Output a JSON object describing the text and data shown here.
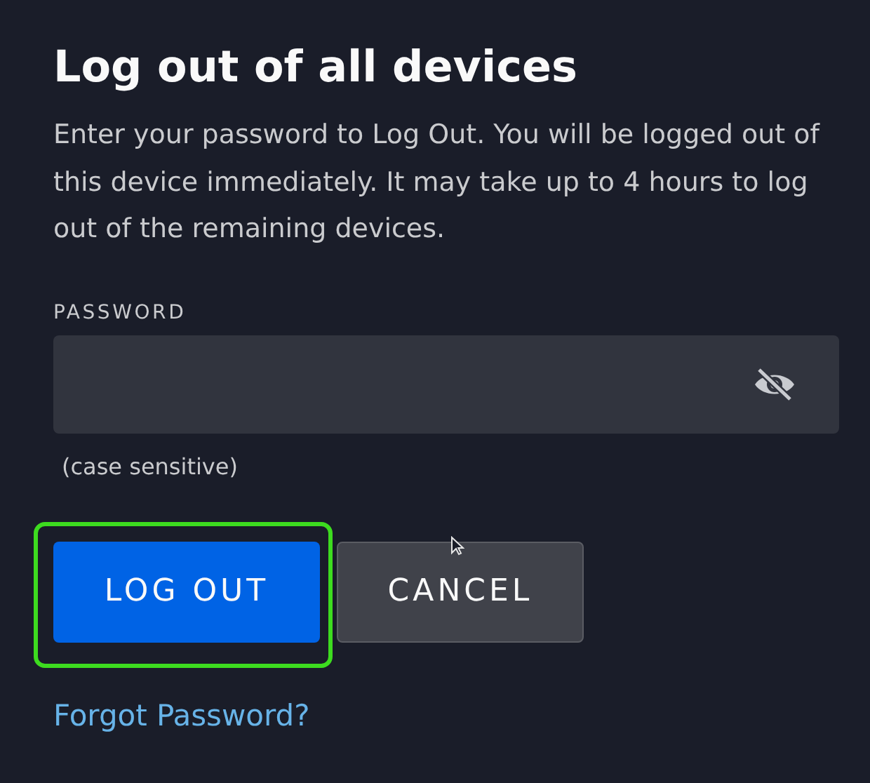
{
  "title": "Log out of all devices",
  "description": "Enter your password to Log Out. You will be logged out of this device immediately. It may take up to 4 hours to log out of the remaining devices.",
  "password": {
    "label": "PASSWORD",
    "hint": "(case sensitive)"
  },
  "buttons": [
    {
      "label": "LOG OUT",
      "kind": "primary",
      "highlighted": true
    },
    {
      "label": "CANCEL",
      "kind": "secondary"
    }
  ],
  "forgot_link": "Forgot Password?"
}
